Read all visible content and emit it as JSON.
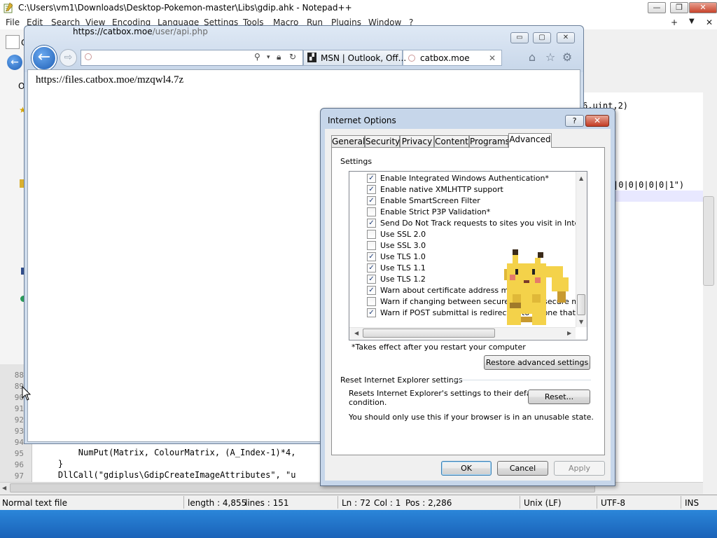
{
  "npp": {
    "title": "C:\\Users\\vm1\\Downloads\\Desktop-Pokemon-master\\Libs\\gdip.ahk - Notepad++",
    "controls": {
      "minimize": "—",
      "maximize": "❐",
      "close": "✕"
    },
    "menu": [
      "File",
      "Edit",
      "Search",
      "View",
      "Encoding",
      "Language",
      "Settings",
      "Tools",
      "Macro",
      "Run",
      "Plugins",
      "Window",
      "?"
    ],
    "menu_right": [
      "+",
      "▼",
      "✕"
    ],
    "left_panel_letter": "C",
    "left_panel_letter2": "O",
    "line_numbers": [
      "88",
      "89",
      "90",
      "91",
      "92",
      "93",
      "94",
      "95",
      "96",
      "97"
    ],
    "code_right_1": "6,uint,2)",
    "code_right_2": "|0|0|0|0|0|1\")",
    "code_95": "        NumPut(Matrix, ColourMatrix, (A_Index-1)*4,",
    "code_96": "    }",
    "code_97": "    DllCall(\"gdiplus\\GdipCreateImageAttributes\", \"u",
    "status": {
      "filetype": "Normal text file",
      "length": "length : 4,855",
      "lines": "lines : 151",
      "ln": "Ln : 72",
      "col": "Col : 1",
      "pos": "Pos : 2,286",
      "eol": "Unix (LF)",
      "encoding": "UTF-8",
      "mode": "INS"
    }
  },
  "ie": {
    "controls": {
      "minimize": "▭",
      "maximize": "▢",
      "close": "✕"
    },
    "address": {
      "host": "https://catbox.moe",
      "path": "/user/api.php"
    },
    "tabs": [
      {
        "label": "MSN | Outlook, Off..."
      },
      {
        "label": "catbox.moe",
        "close": "✕"
      }
    ],
    "page_text": "https://files.catbox.moe/mzqwl4.7z"
  },
  "dialog": {
    "title": "Internet Options",
    "help": "?",
    "close": "✕",
    "tabs": [
      "General",
      "Security",
      "Privacy",
      "Content",
      "Programs",
      "Advanced"
    ],
    "settings_label": "Settings",
    "settings": [
      {
        "label": "Enable Integrated Windows Authentication*",
        "checked": true
      },
      {
        "label": "Enable native XMLHTTP support",
        "checked": true
      },
      {
        "label": "Enable SmartScreen Filter",
        "checked": true
      },
      {
        "label": "Enable Strict P3P Validation*",
        "checked": false
      },
      {
        "label": "Send Do Not Track requests to sites you visit in Internet E",
        "checked": true
      },
      {
        "label": "Use SSL 2.0",
        "checked": false
      },
      {
        "label": "Use SSL 3.0",
        "checked": false
      },
      {
        "label": "Use TLS 1.0",
        "checked": true
      },
      {
        "label": "Use TLS 1.1",
        "checked": true
      },
      {
        "label": "Use TLS 1.2",
        "checked": true
      },
      {
        "label": "Warn about certificate address mismatch*",
        "checked": true
      },
      {
        "label": "Warn if changing between secure and not secure mode",
        "checked": false
      },
      {
        "label": "Warn if POST submittal is redirected to a zone that does n",
        "checked": true
      }
    ],
    "restart_note": "*Takes effect after you restart your computer",
    "restore_button": "Restore advanced settings",
    "reset_group_label": "Reset Internet Explorer settings",
    "reset_desc_1": "Resets Internet Explorer's settings to their default",
    "reset_desc_2": "condition.",
    "reset_button": "Reset...",
    "reset_warning": "You should only use this if your browser is in an unusable state.",
    "ok": "OK",
    "cancel": "Cancel",
    "apply": "Apply"
  }
}
